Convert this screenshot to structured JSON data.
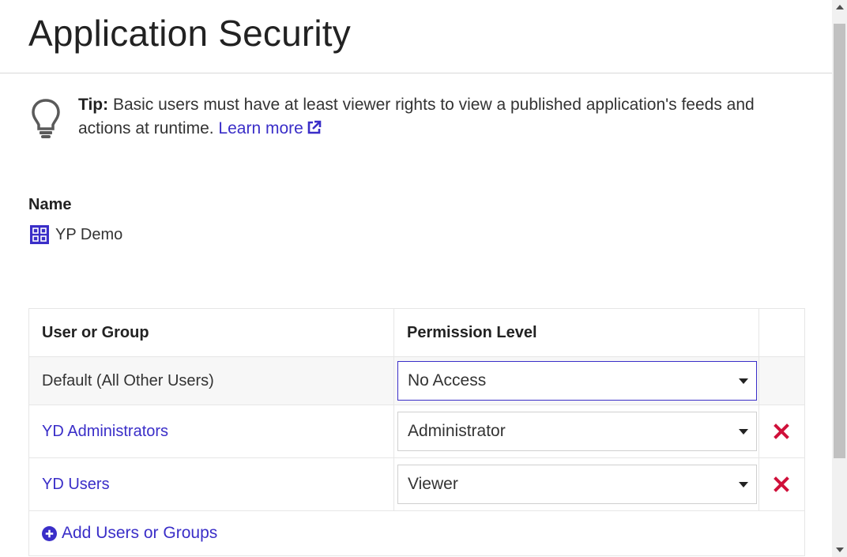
{
  "page": {
    "title": "Application Security"
  },
  "tip": {
    "label": "Tip:",
    "text": " Basic users must have at least viewer rights to view a published application's feeds and actions at runtime. ",
    "link": "Learn more",
    "icon": "lightbulb-icon",
    "link_icon": "external-link-icon"
  },
  "name_section": {
    "label": "Name",
    "app_name": "YP Demo",
    "app_icon": "application-grid-icon"
  },
  "table": {
    "headers": {
      "user_or_group": "User or Group",
      "permission_level": "Permission Level"
    },
    "default_row": {
      "name": "Default (All Other Users)",
      "permission": "No Access"
    },
    "rows": [
      {
        "name": "YD Administrators",
        "permission": "Administrator"
      },
      {
        "name": "YD Users",
        "permission": "Viewer"
      }
    ],
    "add_label": "Add Users or Groups"
  },
  "colors": {
    "accent": "#3a2ec8",
    "remove": "#d0103a",
    "border": "#e6e6e6"
  }
}
